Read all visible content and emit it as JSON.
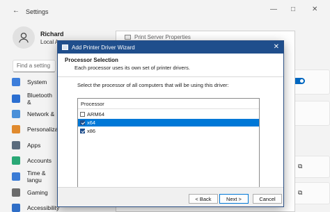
{
  "settings": {
    "title": "Settings",
    "user": {
      "name": "Richard",
      "sub": "Local A"
    },
    "search_placeholder": "Find a setting",
    "nav": [
      {
        "label": "System",
        "color": "#3d7edb"
      },
      {
        "label": "Bluetooth &",
        "color": "#2b6fd1"
      },
      {
        "label": "Network &",
        "color": "#4a90d9"
      },
      {
        "label": "Personalizat",
        "color": "#e08a2e"
      },
      {
        "label": "Apps",
        "color": "#5a6b7d"
      },
      {
        "label": "Accounts",
        "color": "#2aa876"
      },
      {
        "label": "Time & langu",
        "color": "#3a7bd5"
      },
      {
        "label": "Gaming",
        "color": "#6c6c6c"
      },
      {
        "label": "Accessibility",
        "color": "#2f6ec7"
      }
    ]
  },
  "print_server_properties": {
    "title": "Print Server Properties"
  },
  "wizard": {
    "title": "Add Printer Driver Wizard",
    "heading": "Processor Selection",
    "subheading": "Each processor uses its own set of printer drivers.",
    "prompt": "Select the processor of all computers that will be using this driver:",
    "list_header": "Processor",
    "processors": [
      {
        "name": "ARM64",
        "checked": false,
        "selected": false
      },
      {
        "name": "x64",
        "checked": true,
        "selected": true
      },
      {
        "name": "x86",
        "checked": true,
        "selected": false
      }
    ],
    "buttons": {
      "back": "< Back",
      "next": "Next >",
      "cancel": "Cancel"
    }
  },
  "icons": {
    "back": "back-arrow-icon",
    "minimize": "minimize-icon",
    "maximize": "maximize-icon",
    "close": "close-icon",
    "external": "external-link-icon"
  },
  "colors": {
    "accent": "#0067c0",
    "wizard_titlebar": "#1f4e8c",
    "selection": "#0078d7"
  }
}
